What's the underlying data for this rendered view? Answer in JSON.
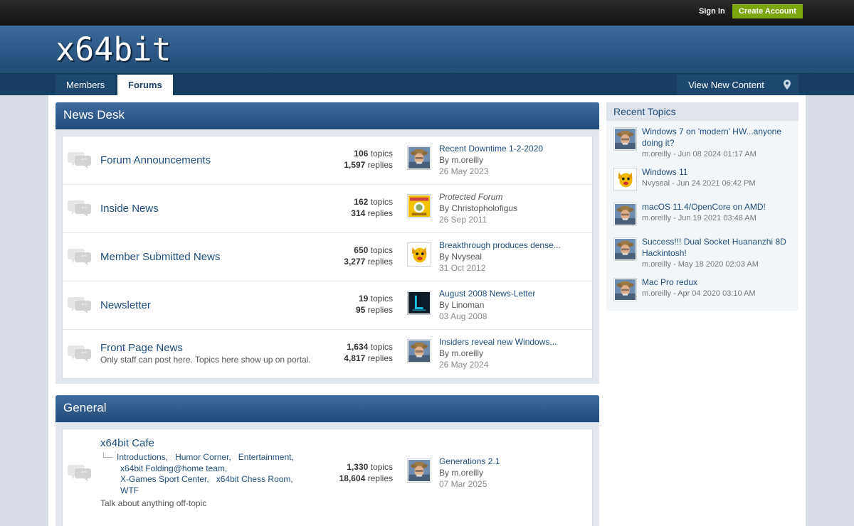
{
  "header": {
    "sign_in": "Sign In",
    "create_account": "Create Account",
    "logo": "x64bit"
  },
  "nav": {
    "members": "Members",
    "forums": "Forums",
    "view_new_content": "View New Content",
    "pin_icon": "map-pin-icon"
  },
  "news_desk": {
    "title": "News Desk",
    "forums": [
      {
        "name": "Forum Announcements",
        "topics": "106",
        "replies": "1,597",
        "last_title": "Recent Downtime 1-2-2020",
        "last_by": "By m.oreilly",
        "last_date": "26 May 2023"
      },
      {
        "name": "Inside News",
        "topics": "162",
        "replies": "314",
        "last_title": "Protected Forum",
        "last_by": "By Christopholofigus",
        "last_date": "26 Sep 2011"
      },
      {
        "name": "Member Submitted News",
        "topics": "650",
        "replies": "3,277",
        "last_title": "Breakthrough produces dense...",
        "last_by": "By Nvyseal",
        "last_date": "31 Oct 2012"
      },
      {
        "name": "Newsletter",
        "topics": "19",
        "replies": "95",
        "last_title": "August 2008 News-Letter",
        "last_by": "By Linoman",
        "last_date": "03 Aug 2008"
      },
      {
        "name": "Front Page News",
        "desc": "Only staff can post here. Topics here show up on portal.",
        "topics": "1,634",
        "replies": "4,817",
        "last_title": "Insiders reveal new Windows...",
        "last_by": "By m.oreilly",
        "last_date": "26 May 2024"
      }
    ]
  },
  "general": {
    "title": "General",
    "forum": {
      "name": "x64bit Cafe",
      "subforums": [
        "Introductions,",
        "Humor Corner,",
        "Entertainment,",
        "x64bit Folding@home team,",
        "X-Games Sport Center,",
        "x64bit Chess Room,",
        "WTF"
      ],
      "desc": "Talk about anything off-topic",
      "topics": "1,330",
      "replies": "18,604",
      "last_title": "Generations 2.1",
      "last_by": "By m.oreilly",
      "last_date": "07 Mar 2025"
    }
  },
  "labels": {
    "topics": "topics",
    "replies": "replies"
  },
  "recent": {
    "title": "Recent Topics",
    "items": [
      {
        "title": "Windows 7 on 'modern' HW...anyone doing it?",
        "meta": "m.oreilly - Jun 08 2024 01:17 AM"
      },
      {
        "title": "Windows 11",
        "meta": "Nvyseal - Jun 24 2021 06:42 PM"
      },
      {
        "title": "macOS 11.4/OpenCore on AMD!",
        "meta": "m.oreilly - Jun 19 2021 03:48 AM"
      },
      {
        "title": "Success!!! Dual Socket Huananzhi 8D Hackintosh!",
        "meta": "m.oreilly - May 18 2020 02:03 AM"
      },
      {
        "title": "Mac Pro redux",
        "meta": "m.oreilly - Apr 04 2020 03:10 AM"
      }
    ]
  }
}
